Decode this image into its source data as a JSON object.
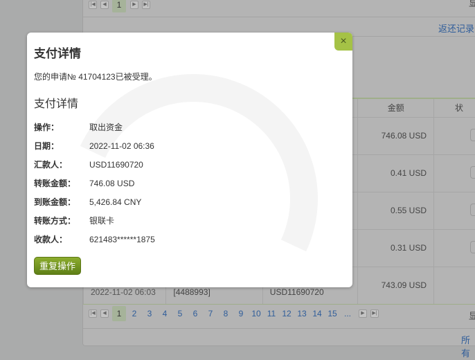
{
  "background": {
    "return_link": "返还记录",
    "all_link": "所有",
    "right_cut_text": "显",
    "table": {
      "headers": [
        "",
        "",
        "",
        "金额",
        "状"
      ],
      "rows": [
        {
          "date": "",
          "id": "",
          "payer": "",
          "amount": "746.08 USD"
        },
        {
          "date": "",
          "id": "",
          "payer": "",
          "amount": "0.41 USD"
        },
        {
          "date": "",
          "id": "",
          "payer": "",
          "amount": "0.55 USD"
        },
        {
          "date": "",
          "id": "",
          "payer": "",
          "amount": "0.31 USD"
        },
        {
          "date": "2022-11-02 06:03",
          "id": "[4488993]",
          "payer": "USD11690720",
          "amount": "743.09 USD"
        }
      ]
    },
    "top_pager_current": "1",
    "pages": [
      "1",
      "2",
      "3",
      "4",
      "5",
      "6",
      "7",
      "8",
      "9",
      "10",
      "11",
      "12",
      "13",
      "14",
      "15",
      "..."
    ],
    "current_page": "1"
  },
  "modal": {
    "title": "支付详情",
    "message": "您的申请№ 41704123已被受理。",
    "section_title": "支付详情",
    "fields": [
      {
        "label": "操作：",
        "value": "取出资金"
      },
      {
        "label": "日期：",
        "value": "2022-11-02 06:36"
      },
      {
        "label": "汇款人：",
        "value": "USD11690720"
      },
      {
        "label": "转账金额：",
        "value": "746.08 USD"
      },
      {
        "label": "到账金额：",
        "value": "5,426.84 CNY"
      },
      {
        "label": "转账方式：",
        "value": "银联卡"
      },
      {
        "label": "收款人：",
        "value": "621483******1875"
      }
    ],
    "repeat_button": "重复操作",
    "close_icon": "×"
  }
}
